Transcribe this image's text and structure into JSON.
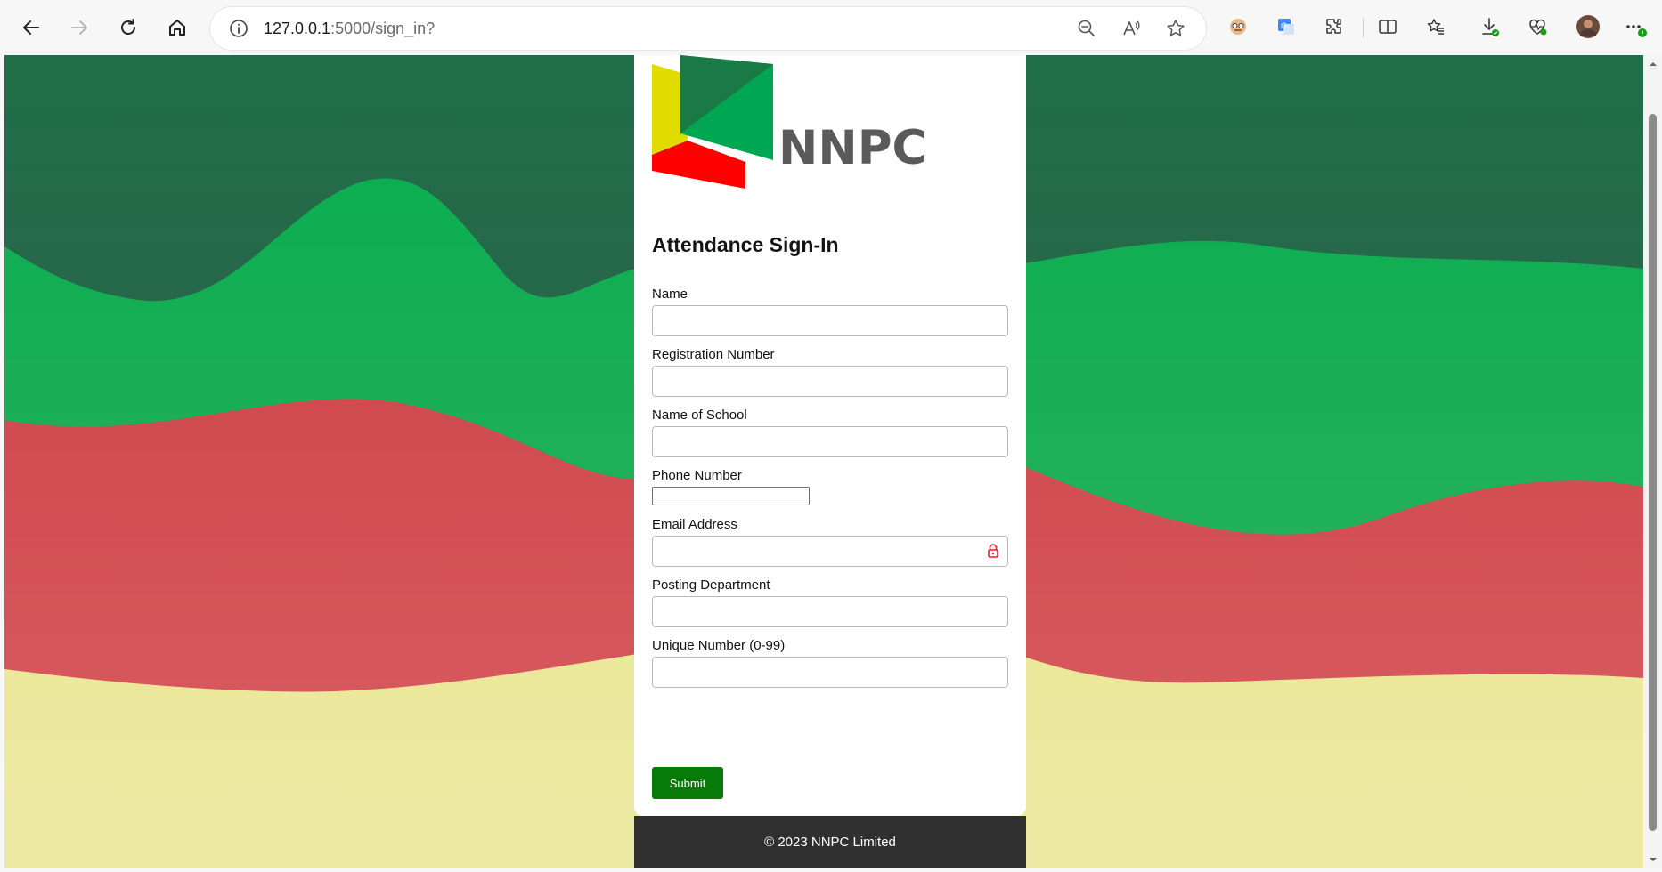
{
  "browser": {
    "url_host": "127.0.0.1",
    "url_rest": ":5000/sign_in?"
  },
  "brand": {
    "logo_text": "NNPC",
    "colors": {
      "green": "#00a651",
      "dark_green": "#1a7a46",
      "red": "#ff0000",
      "yellow": "#e0dc00"
    }
  },
  "form": {
    "title": "Attendance Sign-In",
    "fields": [
      {
        "label": "Name",
        "value": "",
        "placeholder": ""
      },
      {
        "label": "Registration Number",
        "value": "",
        "placeholder": ""
      },
      {
        "label": "Name of School",
        "value": "",
        "placeholder": ""
      },
      {
        "label": "Phone Number",
        "value": "",
        "placeholder": ""
      },
      {
        "label": "Email Address",
        "value": "",
        "placeholder": ""
      },
      {
        "label": "Posting Department",
        "value": "",
        "placeholder": ""
      },
      {
        "label": "Unique Number (0-99)",
        "value": "",
        "placeholder": ""
      }
    ],
    "submit_label": "Submit"
  },
  "footer": {
    "text": "© 2023 NNPC Limited"
  },
  "icons": {
    "back": "back-arrow-icon",
    "forward": "forward-arrow-icon",
    "refresh": "refresh-icon",
    "home": "home-icon",
    "info": "info-icon",
    "zoom": "zoom-out-icon",
    "read_aloud": "read-aloud-icon",
    "favorite": "star-icon",
    "lock": "password-lock-icon"
  }
}
